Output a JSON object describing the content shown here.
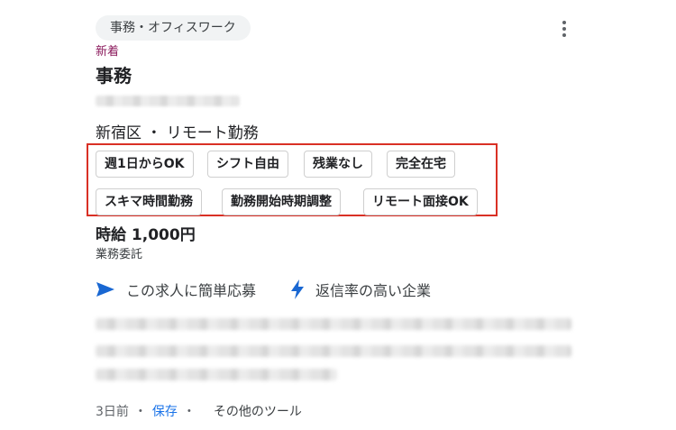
{
  "category": "事務・オフィスワーク",
  "badge": "新着",
  "title": "事務",
  "location": "新宿区 ・ リモート勤務",
  "tags": [
    "週1日からOK",
    "シフト自由",
    "残業なし",
    "完全在宅",
    "スキマ時間勤務",
    "勤務開始時期調整",
    "リモート面接OK"
  ],
  "salary": "時給 1,000円",
  "employment_type": "業務委託",
  "features": [
    {
      "icon": "send-arrow-icon",
      "label": "この求人に簡単応募"
    },
    {
      "icon": "lightning-bolt-icon",
      "label": "返信率の高い企業"
    }
  ],
  "footer": {
    "posted": "3日前",
    "separator": "・",
    "save": "保存",
    "more_tools": "その他のツール"
  },
  "colors": {
    "highlight_border": "#d93025",
    "badge": "#8b1a5c",
    "link": "#1a73e8",
    "feature_icon": "#1967d2"
  }
}
